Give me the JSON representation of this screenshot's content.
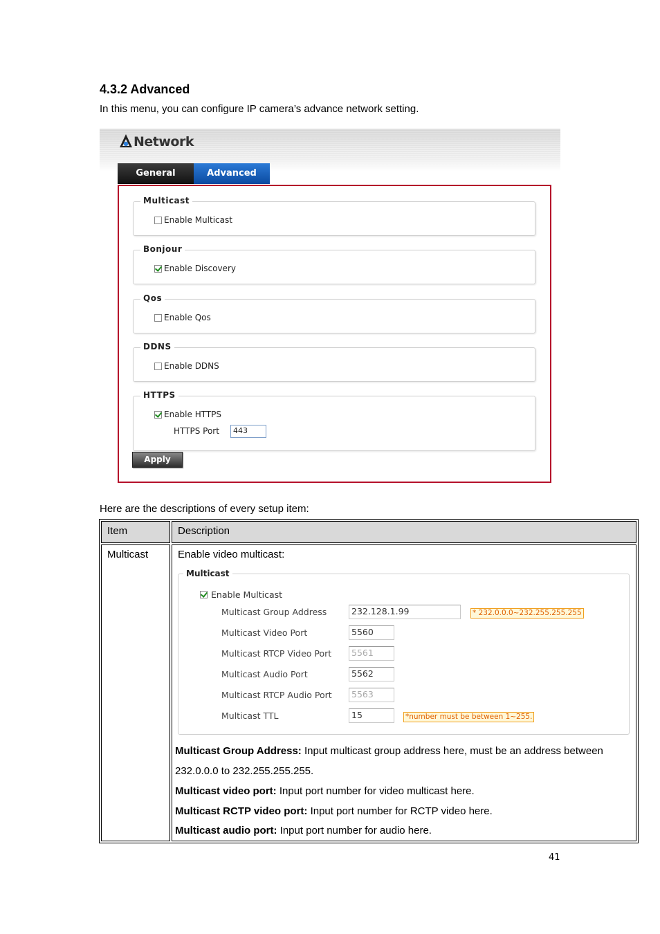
{
  "section": {
    "title": "4.3.2 Advanced",
    "intro": "In this menu, you can configure IP camera’s advance network setting."
  },
  "network_ui": {
    "title": "Network",
    "tabs": {
      "general": "General",
      "advanced": "Advanced"
    },
    "active_tab": "Advanced",
    "groups": {
      "multicast": {
        "legend": "Multicast",
        "option": "Enable Multicast",
        "checked": false
      },
      "bonjour": {
        "legend": "Bonjour",
        "option": "Enable Discovery",
        "checked": true
      },
      "qos": {
        "legend": "Qos",
        "option": "Enable Qos",
        "checked": false
      },
      "ddns": {
        "legend": "DDNS",
        "option": "Enable DDNS",
        "checked": false
      },
      "https": {
        "legend": "HTTPS",
        "option": "Enable HTTPS",
        "checked": true,
        "port_label": "HTTPS Port",
        "port_value": "443"
      }
    },
    "apply_label": "Apply",
    "colors": {
      "panel_border": "#b5102a",
      "active_tab": "#1a5fbf",
      "inactive_tab": "#222222"
    }
  },
  "descriptions": {
    "intro": "Here are the descriptions of every setup item:",
    "headers": {
      "item": "Item",
      "description": "Description"
    },
    "row": {
      "item": "Multicast",
      "lead": "Enable video multicast:",
      "screenshot": {
        "legend": "Multicast",
        "enable_label": "Enable Multicast",
        "enable_checked": true,
        "fields": {
          "group_address": {
            "label": "Multicast Group Address",
            "value": "232.128.1.99",
            "hint": "* 232.0.0.0~232.255.255.255"
          },
          "video_port": {
            "label": "Multicast Video Port",
            "value": "5560"
          },
          "rtcp_video_port": {
            "label": "Multicast RTCP Video Port",
            "value": "5561"
          },
          "audio_port": {
            "label": "Multicast Audio Port",
            "value": "5562"
          },
          "rtcp_audio_port": {
            "label": "Multicast RTCP Audio Port",
            "value": "5563"
          },
          "ttl": {
            "label": "Multicast TTL",
            "value": "15",
            "hint": "*number must be between 1~255."
          }
        }
      },
      "paragraphs": {
        "p1_term": "Multicast Group Address:",
        "p1_text": " Input multicast group address here, must be an address between",
        "p1_cont": "232.0.0.0 to 232.255.255.255.",
        "p2_term": "Multicast video port:",
        "p2_text": " Input port number for video multicast here.",
        "p3_term": "Multicast RCTP video port:",
        "p3_text": " Input port number for RCTP video here.",
        "p4_term": "Multicast audio port:",
        "p4_text": " Input port number for audio here."
      }
    }
  },
  "page_number": "41"
}
